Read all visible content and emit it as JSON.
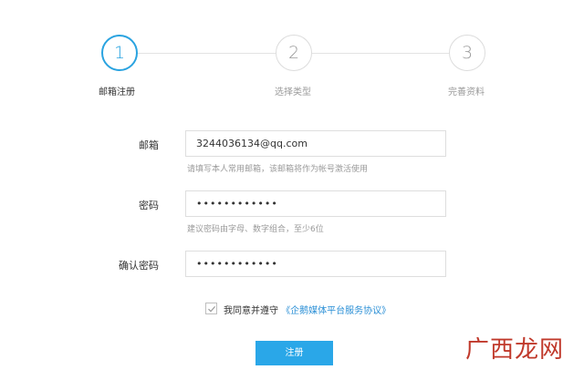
{
  "steps": [
    {
      "number": "1",
      "label": "邮箱注册",
      "active": true
    },
    {
      "number": "2",
      "label": "选择类型",
      "active": false
    },
    {
      "number": "3",
      "label": "完善资料",
      "active": false
    }
  ],
  "form": {
    "email": {
      "label": "邮箱",
      "value": "3244036134@qq.com",
      "hint": "请填写本人常用邮箱，该邮箱将作为帐号激活使用"
    },
    "password": {
      "label": "密码",
      "value": "••••••••••••",
      "hint": "建议密码由字母、数字组合，至少6位"
    },
    "confirm": {
      "label": "确认密码",
      "value": "••••••••••••"
    }
  },
  "agreement": {
    "prefix": "我同意并遵守",
    "link": "《企鹅媒体平台服务协议》",
    "checked": true
  },
  "submit_label": "注册",
  "watermark": {
    "text": "广西龙网"
  },
  "colors": {
    "accent": "#2aa3e0",
    "button": "#2aa7e8",
    "link": "#2a8fd6",
    "watermark": "#c0392b"
  }
}
